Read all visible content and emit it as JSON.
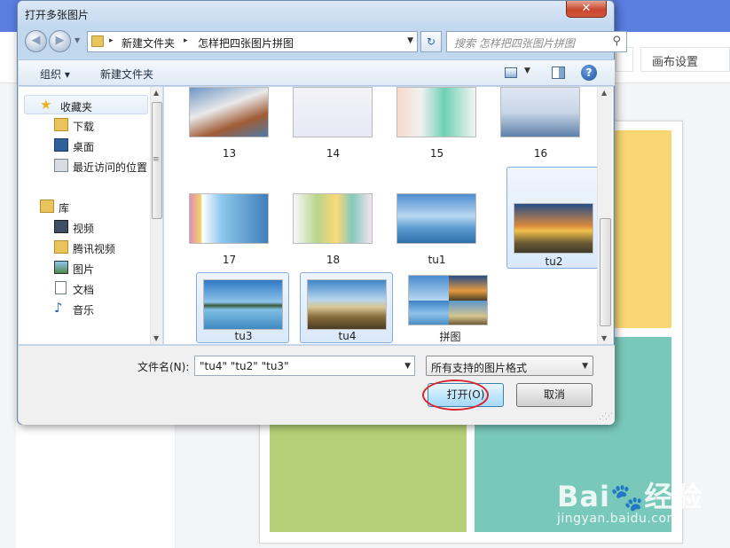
{
  "background_app": {
    "canvas_settings_label": "画布设置",
    "watermark": {
      "logo": "Bai",
      "logo_paw": "🐾",
      "logo_suffix": "经验",
      "url": "jingyan.baidu.com"
    },
    "colors": {
      "topbar": "#5a7de0",
      "yellow": "#fbd774",
      "green": "#b5d078",
      "teal": "#79c9bb"
    }
  },
  "dialog": {
    "title": "打开多张图片",
    "close_glyph": "✕",
    "address": {
      "crumbs": [
        "新建文件夹",
        "怎样把四张图片拼图"
      ],
      "separator": "▸"
    },
    "search_placeholder": "搜索 怎样把四张图片拼图",
    "toolbar": {
      "organize_label": "组织 ▾",
      "new_folder_label": "新建文件夹"
    },
    "nav": {
      "favorites_label": "收藏夹",
      "favorites_items": [
        "下载",
        "桌面",
        "最近访问的位置"
      ],
      "libraries_label": "库",
      "libraries_items": [
        "视频",
        "腾讯视频",
        "图片",
        "文档",
        "音乐"
      ]
    },
    "files": [
      {
        "name": "13",
        "selected": false
      },
      {
        "name": "14",
        "selected": false
      },
      {
        "name": "15",
        "selected": false
      },
      {
        "name": "16",
        "selected": false
      },
      {
        "name": "17",
        "selected": false
      },
      {
        "name": "18",
        "selected": false
      },
      {
        "name": "tu1",
        "selected": false
      },
      {
        "name": "tu2",
        "selected": true
      },
      {
        "name": "tu3",
        "selected": true
      },
      {
        "name": "tu4",
        "selected": true
      },
      {
        "name": "拼图",
        "selected": false
      }
    ],
    "filename_label": "文件名(N):",
    "filename_value": "\"tu4\" \"tu2\" \"tu3\"",
    "filetype_value": "所有支持的图片格式",
    "open_button": "打开(O)",
    "cancel_button": "取消"
  }
}
